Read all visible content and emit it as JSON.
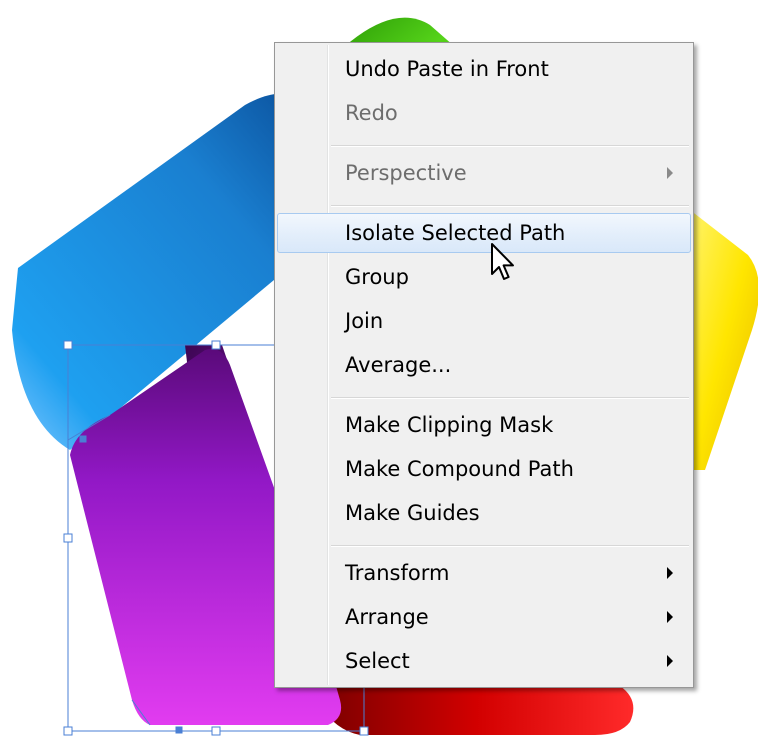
{
  "context_menu": {
    "items": [
      {
        "label": "Undo Paste in Front",
        "enabled": true,
        "submenu": false
      },
      {
        "label": "Redo",
        "enabled": false,
        "submenu": false
      },
      {
        "label": "Perspective",
        "enabled": false,
        "submenu": true
      },
      {
        "label": "Isolate Selected Path",
        "enabled": true,
        "submenu": false,
        "highlighted": true
      },
      {
        "label": "Group",
        "enabled": true,
        "submenu": false
      },
      {
        "label": "Join",
        "enabled": true,
        "submenu": false
      },
      {
        "label": "Average...",
        "enabled": true,
        "submenu": false
      },
      {
        "label": "Make Clipping Mask",
        "enabled": true,
        "submenu": false
      },
      {
        "label": "Make Compound Path",
        "enabled": true,
        "submenu": false
      },
      {
        "label": "Make Guides",
        "enabled": true,
        "submenu": false
      },
      {
        "label": "Transform",
        "enabled": true,
        "submenu": true
      },
      {
        "label": "Arrange",
        "enabled": true,
        "submenu": true
      },
      {
        "label": "Select",
        "enabled": true,
        "submenu": true
      }
    ]
  },
  "artwork": {
    "ribbon_colors": {
      "green": "#3bb200",
      "blue": "#1a8fe0",
      "yellow": "#ffe600",
      "red": "#d40000",
      "magenta": "#c21ed6"
    },
    "selection_color": "#4a7fd4"
  },
  "icons": {
    "submenu": "submenu-arrow-icon",
    "cursor": "mouse-pointer-icon"
  }
}
